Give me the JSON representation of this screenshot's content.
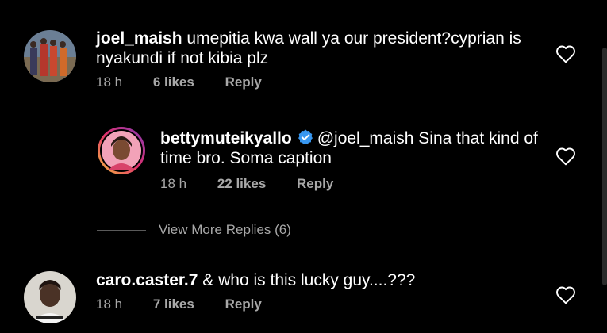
{
  "comments": [
    {
      "username": "joel_maish",
      "text_line1": "umepitia kwa wall ya our president?cyprian is",
      "text_line2": "nyakundi if not kibia plz",
      "time": "18 h",
      "likes": "6 likes",
      "reply": "Reply"
    },
    {
      "username": "bettymuteikyallo",
      "mention": "@joel_maish",
      "text_line1": "Sina that kind of",
      "text_line2": "time bro. Soma caption",
      "time": "18 h",
      "likes": "22 likes",
      "reply": "Reply"
    },
    {
      "username": "caro.caster.7",
      "text_line1": "& who is this lucky guy....???",
      "time": "18 h",
      "likes": "7 likes",
      "reply": "Reply"
    }
  ],
  "view_more_replies": "View More Replies (6)",
  "colors": {
    "background": "#000000",
    "text": "#ffffff",
    "secondary": "#a8a8a8",
    "verified": "#3897f0"
  },
  "icons": {
    "like": "heart-outline-icon",
    "verified": "verified-badge-icon"
  }
}
